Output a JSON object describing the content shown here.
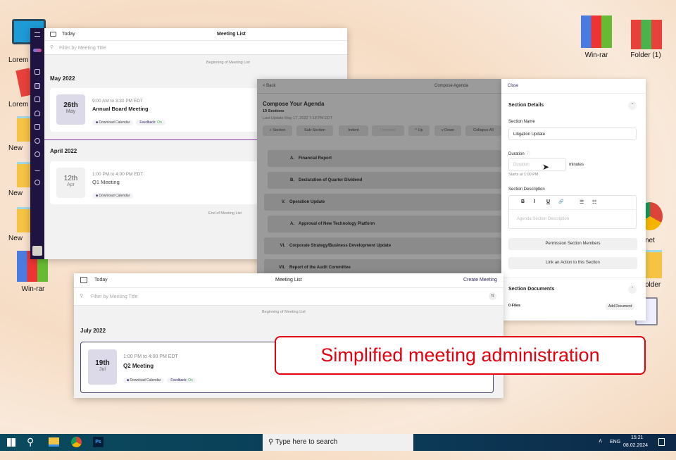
{
  "desktop": {
    "left_icons": [
      {
        "label": "Lorem",
        "icon": "monitor-icon"
      },
      {
        "label": "Lorem",
        "icon": "binder-icon"
      },
      {
        "label": "New",
        "icon": "folder-icon"
      },
      {
        "label": "New",
        "icon": "folder-icon"
      },
      {
        "label": "New",
        "icon": "folder-icon"
      },
      {
        "label": "Win-rar",
        "icon": "winrar-icon"
      }
    ],
    "right_icons": [
      {
        "label": "Win-rar",
        "icon": "winrar-icon"
      },
      {
        "label": "Folder (1)",
        "icon": "binders-icon"
      },
      {
        "label": "net",
        "icon": "chrome-icon"
      },
      {
        "label": "older",
        "icon": "folder-icon"
      }
    ]
  },
  "window1": {
    "today": "Today",
    "title": "Meeting List",
    "search_placeholder": "Filter by Meeting Title",
    "beginning": "Beginning of Meeting List",
    "end": "End of Meeting List",
    "groups": [
      {
        "month": "May 2022",
        "day": "26th",
        "mon": "May",
        "time": "9:00 AM to 3:30 PM EDT",
        "name": "Annual Board Meeting",
        "calendar": "Download Calendar",
        "feedback": "Feedback:",
        "feedback_state": "On"
      },
      {
        "month": "April 2022",
        "day": "12th",
        "mon": "Apr",
        "time": "1:00 PM to 4:00 PM EDT",
        "name": "Q1 Meeting",
        "calendar": "Download Calendar"
      }
    ]
  },
  "agenda": {
    "back": "< Back",
    "title": "Compose Agenda",
    "heading": "Compose Your Agenda",
    "sections": "19 Sections",
    "last_update": "Last Update May 17, 2022 7:18 PM EDT",
    "toolbar": [
      "+ Section",
      "Sub-Section",
      "Indent",
      "Unindent",
      "^ Up",
      "v Down",
      "Collapse All"
    ],
    "items": [
      {
        "num": "A.",
        "text": "Financial Report",
        "sub": true
      },
      {
        "num": "B.",
        "text": "Declaration of Quarter Dividend",
        "sub": true
      },
      {
        "num": "V.",
        "text": "Operation Update",
        "sub": false
      },
      {
        "num": "A.",
        "text": "Approval of New Technology Platform",
        "sub": true
      },
      {
        "num": "VI.",
        "text": "Corporate Strategy/Business Development Update",
        "sub": false
      },
      {
        "num": "VII.",
        "text": "Report of the Audit Committee",
        "sub": false
      }
    ]
  },
  "panel": {
    "close": "Close",
    "section_details": "Section Details",
    "section_name_label": "Section Name",
    "section_name_value": "Litigation Update",
    "duration_label": "Duration",
    "duration_placeholder": "Duration",
    "minutes": "minutes",
    "starts": "Starts at 1:00 PM",
    "desc_label": "Section Description",
    "desc_placeholder": "Agenda Section Description",
    "fmt": [
      "B",
      "I",
      "U",
      "🔗",
      "☰",
      "☷"
    ],
    "permission": "Permission Section Members",
    "link_action": "Link an Action to this Section",
    "documents": "Section Documents",
    "files": "0 Files",
    "add_document": "Add Document"
  },
  "window3": {
    "today": "Today",
    "title": "Meeting List",
    "create": "Create Meeting",
    "search_placeholder": "Filter by Meeting Title",
    "beginning": "Beginning of Meeting List",
    "month": "July 2022",
    "day": "19th",
    "mon": "Jul",
    "time": "1:00 PM to 4:00 PM EDT",
    "name": "Q2 Meeting",
    "calendar": "Download Calendar",
    "feedback": "Feedback:",
    "feedback_state": "On"
  },
  "callout": "Simplified meeting administration",
  "taskbar": {
    "search": "Type here to search",
    "lang": "ENG",
    "time": "15:21",
    "date": "08.02.2024"
  },
  "colors": {
    "sidebar": "#1f1440",
    "accent": "#8b3fa0",
    "callout": "#e3000f",
    "taskbar": "#0b3f57"
  }
}
